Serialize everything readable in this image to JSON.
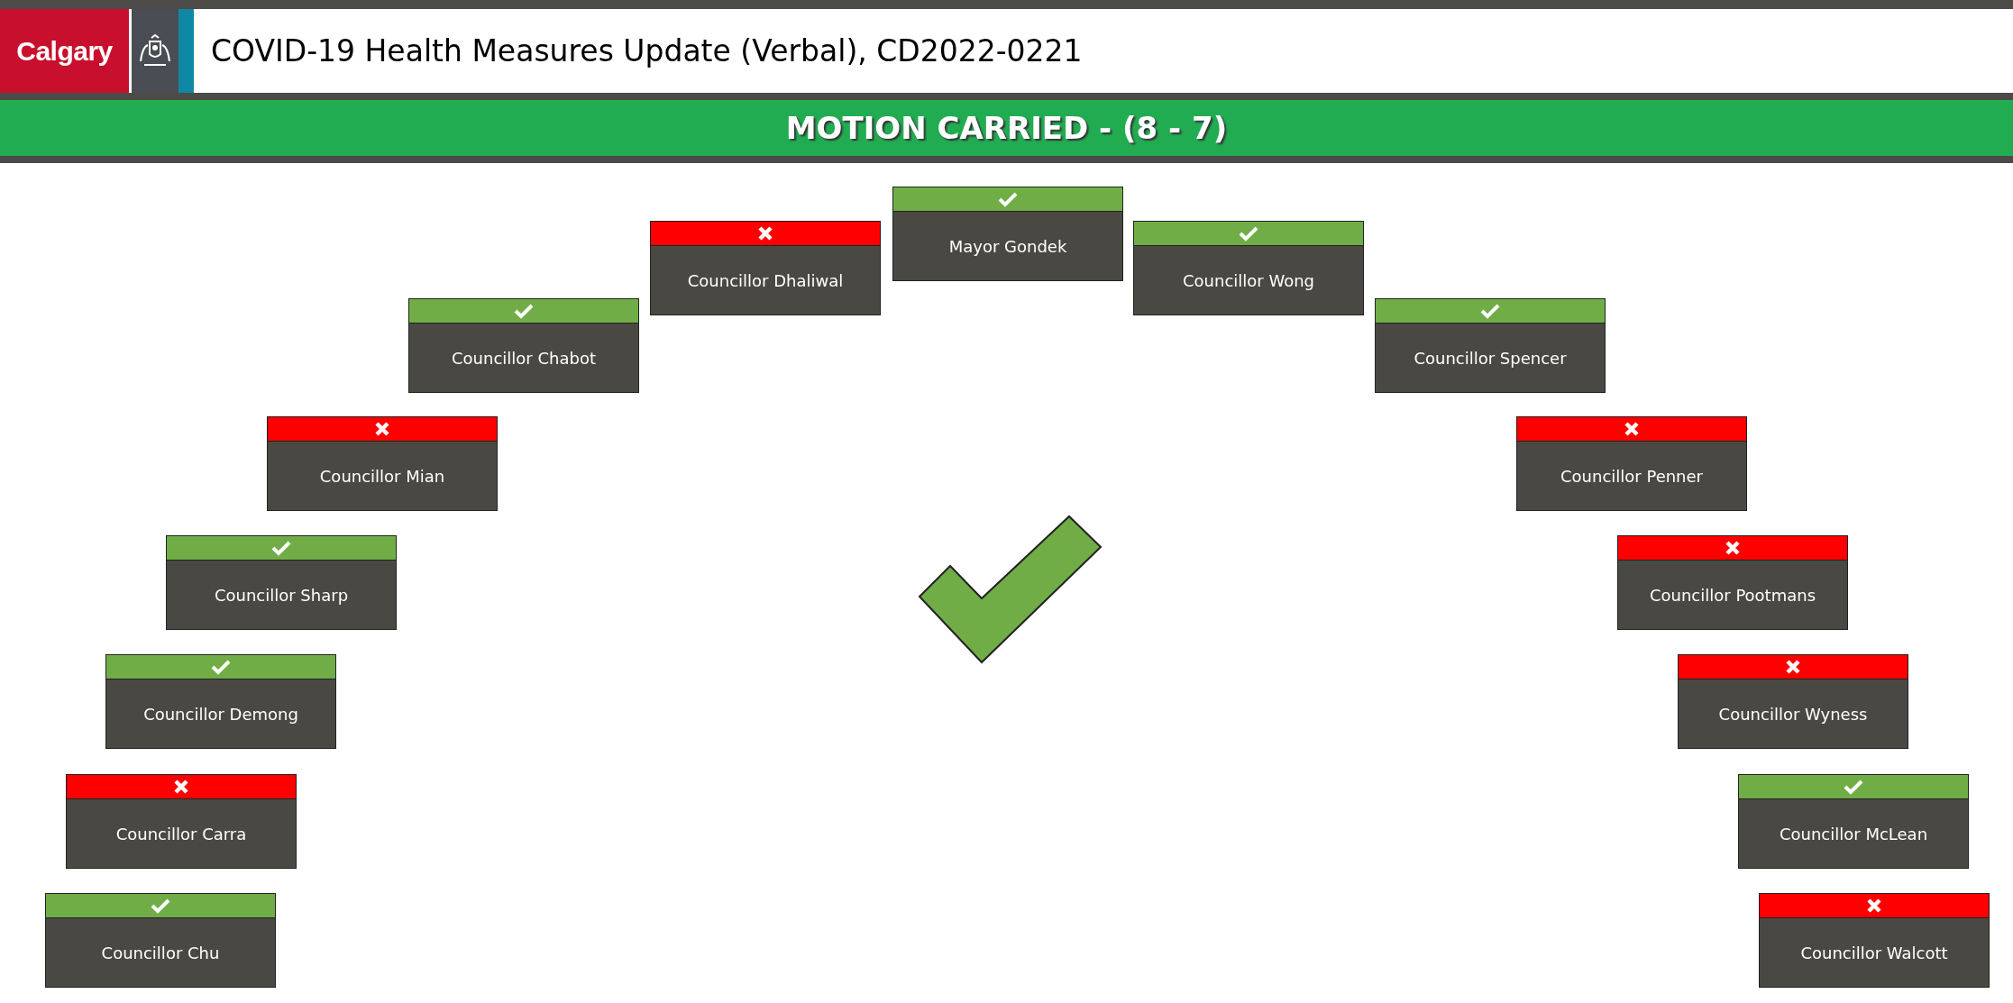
{
  "header": {
    "logo_text": "Calgary",
    "title": "COVID-19 Health Measures Update (Verbal), CD2022-0221"
  },
  "banner": {
    "text": "MOTION CARRIED - (8 - 7)",
    "carried": true
  },
  "votes": [
    {
      "name": "Mayor Gondek",
      "in_favour": true
    },
    {
      "name": "Councillor Dhaliwal",
      "in_favour": false
    },
    {
      "name": "Councillor Wong",
      "in_favour": true
    },
    {
      "name": "Councillor Chabot",
      "in_favour": true
    },
    {
      "name": "Councillor Spencer",
      "in_favour": true
    },
    {
      "name": "Councillor Mian",
      "in_favour": false
    },
    {
      "name": "Councillor Penner",
      "in_favour": false
    },
    {
      "name": "Councillor Sharp",
      "in_favour": true
    },
    {
      "name": "Councillor Pootmans",
      "in_favour": false
    },
    {
      "name": "Councillor Demong",
      "in_favour": true
    },
    {
      "name": "Councillor Wyness",
      "in_favour": false
    },
    {
      "name": "Councillor Carra",
      "in_favour": false
    },
    {
      "name": "Councillor McLean",
      "in_favour": true
    },
    {
      "name": "Councillor Chu",
      "in_favour": true
    },
    {
      "name": "Councillor Walcott",
      "in_favour": false
    }
  ]
}
